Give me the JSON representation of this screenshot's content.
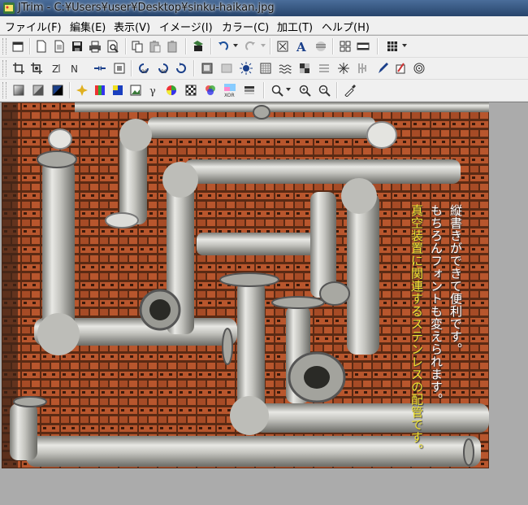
{
  "window": {
    "title": "JTrim - C:¥Users¥user¥Desktop¥sinku-haikan.jpg"
  },
  "menu": [
    "ファイル(F)",
    "編集(E)",
    "表示(V)",
    "イメージ(I)",
    "カラー(C)",
    "加工(T)",
    "ヘルプ(H)"
  ],
  "toolbars": {
    "row1": [
      "new-window-icon",
      "new-file-icon",
      "open-icon",
      "save-icon",
      "print-icon",
      "print-preview-icon",
      "copy-icon",
      "paste-icon",
      "paste-new-icon",
      "capture-icon",
      "undo-icon",
      "redo-icon",
      "fit-window-icon",
      "text-icon",
      "align-icon",
      "grid-view-icon",
      "panel-icon",
      "tile-icon"
    ],
    "row2": [
      "crop-icon",
      "rotate-free-icon",
      "flip-horizontal-icon",
      "flip-vertical-icon",
      "mirror-icon",
      "frame-icon",
      "rotate-left-90-icon",
      "rotate-right-90-icon",
      "rotate-icon",
      "emboss-icon",
      "canvas-icon",
      "brightness-icon",
      "pattern-icon",
      "wave-icon",
      "mosaic-icon",
      "blur-icon",
      "sparkle-icon",
      "sharpen-icon",
      "pen-icon",
      "highlight-icon",
      "spiral-icon"
    ],
    "row3": [
      "gradient-icon",
      "fill-icon",
      "border-icon",
      "sparkle-color-icon",
      "histogram-icon",
      "color-balance-icon",
      "image-icon",
      "gamma-icon",
      "hue-icon",
      "checker-icon",
      "rgb-icon",
      "xor-icon",
      "grayscale-icon",
      "zoom-dropdown-icon",
      "zoom-in-icon",
      "zoom-out-icon",
      "eyedropper-icon"
    ]
  },
  "overlay_text": {
    "line1": "縦書きができて便利です。",
    "line2": "もちろんフォントも変えられます。",
    "line3": "真空装置に関連するステンレスの配管です。"
  },
  "colors": {
    "text_white": "#ffffff",
    "text_yellow": "#f1e330",
    "pallet": "#b5532c",
    "pipe": "#cfcfcb"
  }
}
